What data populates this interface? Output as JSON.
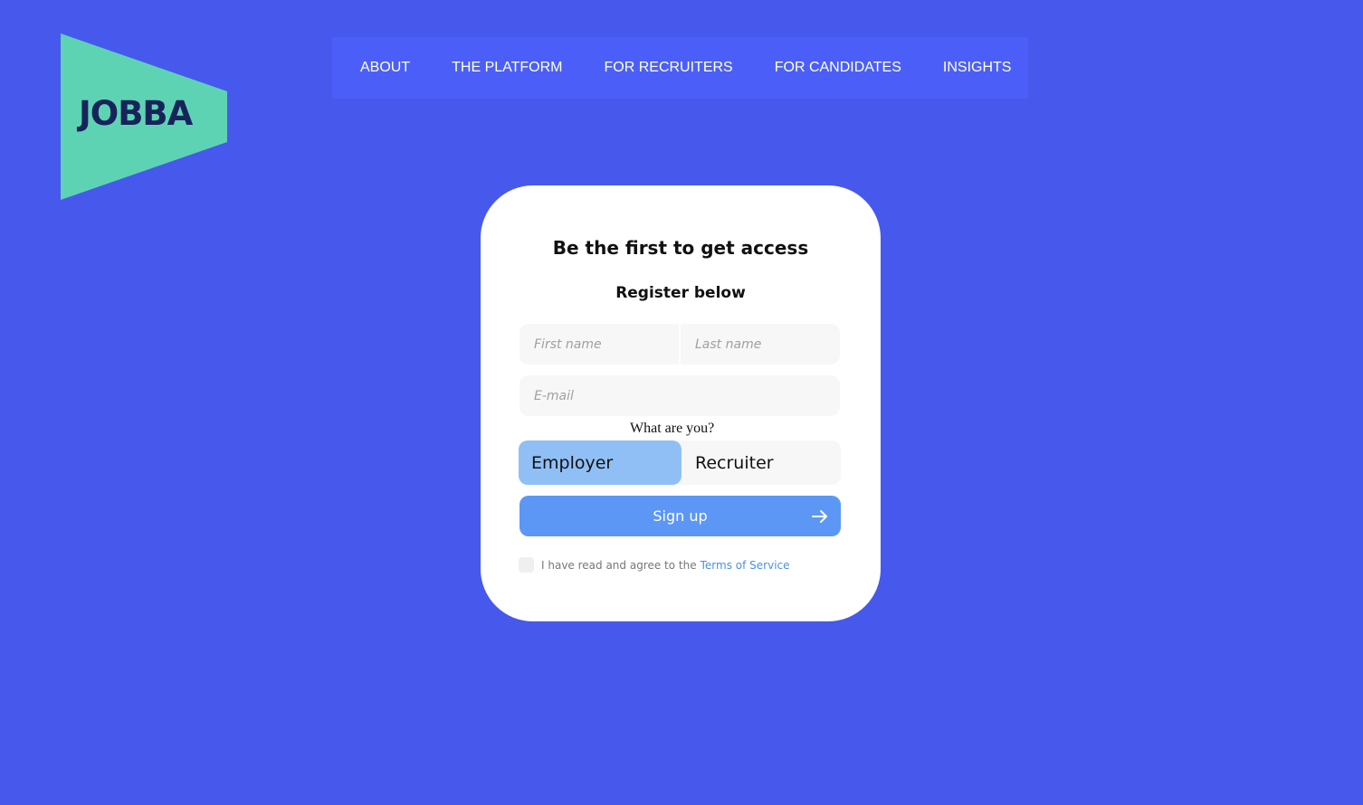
{
  "brand": {
    "logo_text": "JOBBA",
    "logo_color": "#5ED3B4",
    "logo_text_color": "#16245A",
    "background_color": "#4659EC"
  },
  "nav": {
    "items": [
      {
        "label": "ABOUT"
      },
      {
        "label": "THE PLATFORM"
      },
      {
        "label": "FOR RECRUITERS"
      },
      {
        "label": "FOR CANDIDATES"
      },
      {
        "label": "INSIGHTS"
      }
    ]
  },
  "signup_card": {
    "title": "Be the first to get access",
    "subtitle": "Register below",
    "first_name": {
      "placeholder": "First name",
      "value": ""
    },
    "last_name": {
      "placeholder": "Last name",
      "value": ""
    },
    "email": {
      "placeholder": "E-mail",
      "value": ""
    },
    "role_question": "What are you?",
    "roles": [
      {
        "label": "Employer",
        "selected": true
      },
      {
        "label": "Recruiter",
        "selected": false
      }
    ],
    "signup_button": {
      "label": "Sign up",
      "icon": "arrow-right-icon",
      "color": "#5C97F6"
    },
    "terms": {
      "text": "I have read and agree to the",
      "link_text": "Terms of Service",
      "checked": false,
      "link_color": "#4A90E2"
    }
  }
}
